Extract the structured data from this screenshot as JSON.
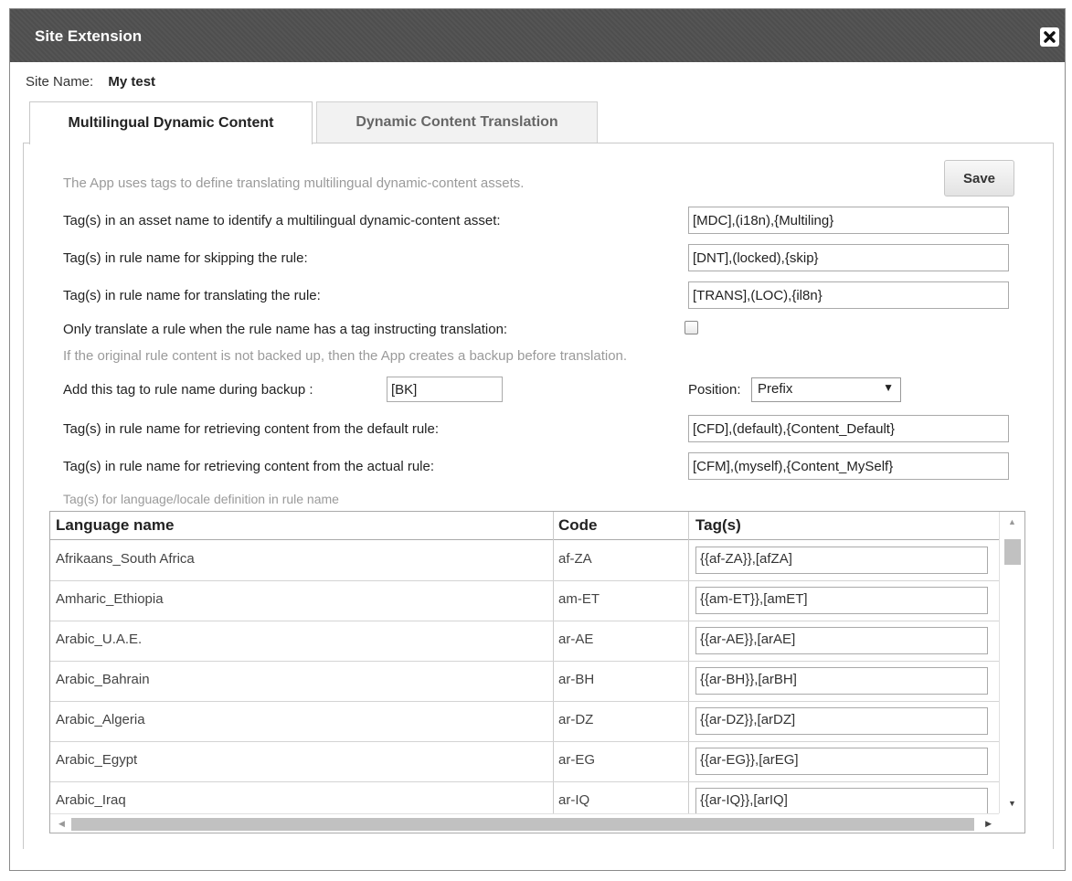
{
  "dialog": {
    "title": "Site Extension",
    "close_icon": "close-icon"
  },
  "site": {
    "label": "Site Name:",
    "value": "My test"
  },
  "tabs": [
    {
      "label": "Multilingual Dynamic Content",
      "active": true
    },
    {
      "label": "Dynamic Content Translation",
      "active": false
    }
  ],
  "form": {
    "save_label": "Save",
    "intro_hint": "The App uses tags to define translating multilingual dynamic-content assets.",
    "asset_tag_label": "Tag(s) in an asset name to identify a multilingual dynamic-content asset:",
    "asset_tag_value": "[MDC],(i18n),{Multiling}",
    "skip_tag_label": "Tag(s) in rule name for skipping the rule:",
    "skip_tag_value": "[DNT],(locked),{skip}",
    "translate_tag_label": "Tag(s) in rule name for translating the rule:",
    "translate_tag_value": "[TRANS],(LOC),{il8n}",
    "only_translate_label": "Only translate a rule when the rule name has a tag instructing translation:",
    "only_translate_checked": false,
    "backup_hint": "If the original rule content is not backed up, then the App creates a backup before translation.",
    "backup_tag_label": "Add this tag to rule name during backup :",
    "backup_tag_value": "[BK]",
    "position_label": "Position:",
    "position_value": "Prefix",
    "default_tag_label": "Tag(s) in rule name for retrieving content from the default rule:",
    "default_tag_value": "[CFD],(default),{Content_Default}",
    "actual_tag_label": "Tag(s) in rule name for retrieving content from the actual rule:",
    "actual_tag_value": "[CFM],(myself),{Content_MySelf}",
    "locale_hint": "Tag(s) for language/locale definition in rule name"
  },
  "grid": {
    "columns": [
      "Language name",
      "Code",
      "Tag(s)"
    ],
    "rows": [
      {
        "name": "Afrikaans_South Africa",
        "code": "af-ZA",
        "tags": "{{af-ZA}},[afZA]"
      },
      {
        "name": "Amharic_Ethiopia",
        "code": "am-ET",
        "tags": "{{am-ET}},[amET]"
      },
      {
        "name": "Arabic_U.A.E.",
        "code": "ar-AE",
        "tags": "{{ar-AE}},[arAE]"
      },
      {
        "name": "Arabic_Bahrain",
        "code": "ar-BH",
        "tags": "{{ar-BH}},[arBH]"
      },
      {
        "name": "Arabic_Algeria",
        "code": "ar-DZ",
        "tags": "{{ar-DZ}},[arDZ]"
      },
      {
        "name": "Arabic_Egypt",
        "code": "ar-EG",
        "tags": "{{ar-EG}},[arEG]"
      },
      {
        "name": "Arabic_Iraq",
        "code": "ar-IQ",
        "tags": "{{ar-IQ}},[arIQ]"
      }
    ]
  }
}
